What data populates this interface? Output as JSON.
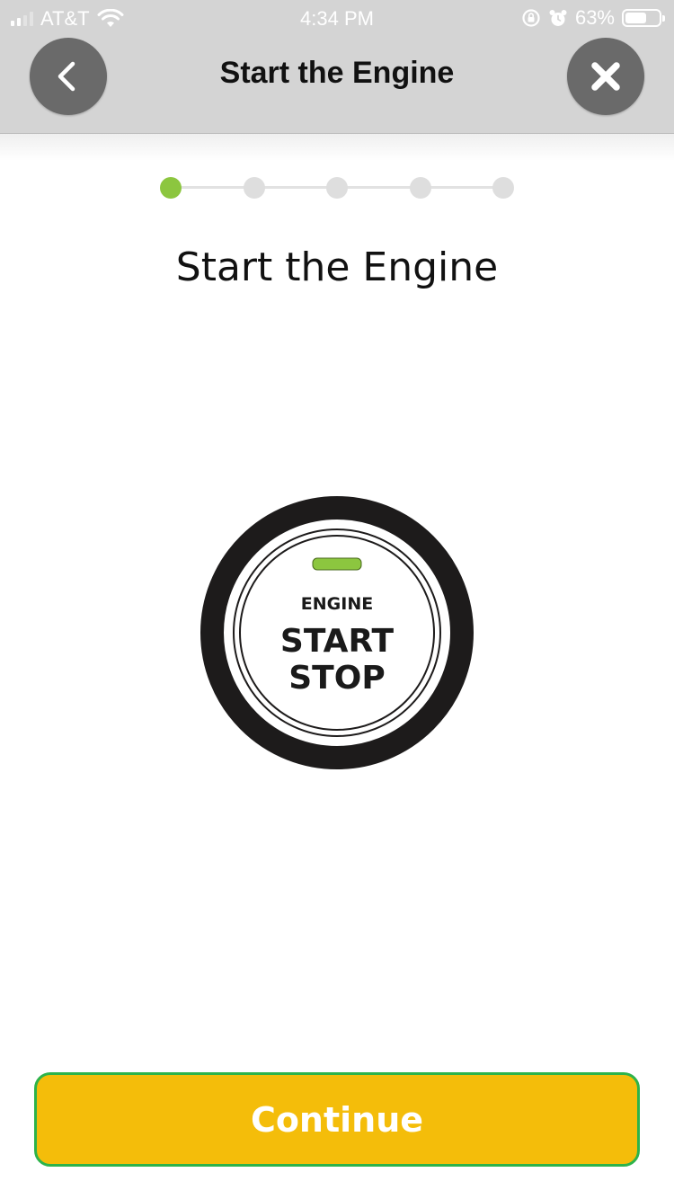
{
  "status_bar": {
    "carrier": "AT&T",
    "time": "4:34 PM",
    "battery_percent_label": "63%",
    "battery_level": 0.63
  },
  "nav": {
    "title": "Start the Engine",
    "back_icon": "chevron-left-icon",
    "close_icon": "close-icon"
  },
  "stepper": {
    "total_steps": 5,
    "current_step": 1
  },
  "main": {
    "heading": "Start the Engine",
    "engine_button": {
      "line1": "ENGINE",
      "line2": "START",
      "line3": "STOP",
      "indicator_color": "#8cc63f"
    }
  },
  "footer": {
    "continue_label": "Continue"
  },
  "colors": {
    "accent_green": "#8cc63f",
    "button_yellow": "#f4bd0a",
    "button_border": "#2db34a",
    "nav_gray": "#d4d4d4",
    "nav_button": "#6a6a6a"
  }
}
